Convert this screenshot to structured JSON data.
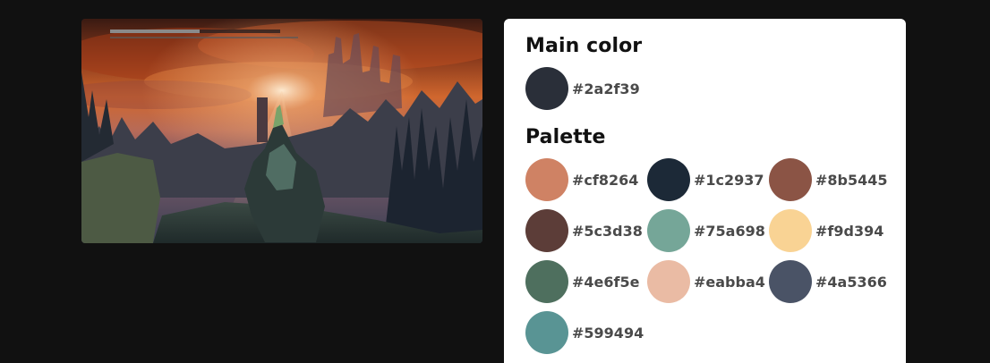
{
  "main_color": {
    "heading": "Main color",
    "hex": "#2a2f39",
    "color": "#2a2f39"
  },
  "palette": {
    "heading": "Palette",
    "swatches": [
      {
        "hex": "#cf8264",
        "color": "#cf8264"
      },
      {
        "hex": "#1c2937",
        "color": "#1c2937"
      },
      {
        "hex": "#8b5445",
        "color": "#8b5445"
      },
      {
        "hex": "#5c3d38",
        "color": "#5c3d38"
      },
      {
        "hex": "#75a698",
        "color": "#75a698"
      },
      {
        "hex": "#f9d394",
        "color": "#f9d394"
      },
      {
        "hex": "#4e6f5e",
        "color": "#4e6f5e"
      },
      {
        "hex": "#eabba4",
        "color": "#eabba4"
      },
      {
        "hex": "#4a5366",
        "color": "#4a5366"
      },
      {
        "hex": "#599494",
        "color": "#599494"
      }
    ]
  },
  "preview_image": {
    "icon": "landscape-image"
  }
}
